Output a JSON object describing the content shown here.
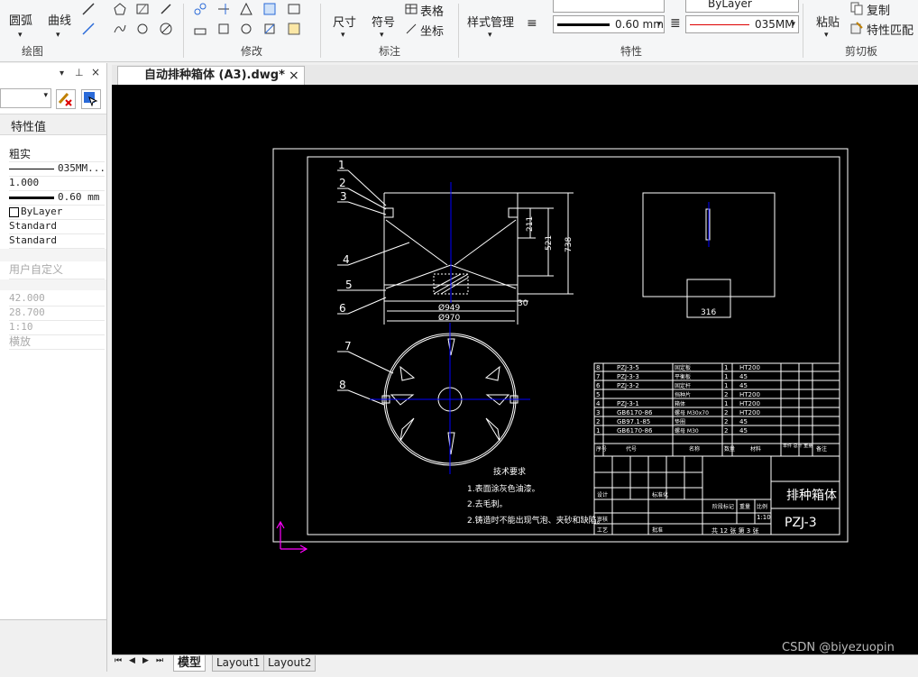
{
  "ribbon": {
    "draw": {
      "arc": "圆弧",
      "curve": "曲线",
      "group": "绘图"
    },
    "modify": {
      "group": "修改"
    },
    "annotate": {
      "dim": "尺寸",
      "symbol": "符号",
      "table": "表格",
      "coord": "坐标",
      "group": "标注"
    },
    "props": {
      "style_mgr": "样式管理",
      "lineweight": "0.60 mm",
      "bylayer": "ByLayer",
      "linetype": "035MM",
      "group": "特性"
    },
    "clipboard": {
      "paste": "粘贴",
      "copy": "复制",
      "match": "特性匹配",
      "group": "剪切板"
    }
  },
  "left_panel": {
    "header": "特性值",
    "rows": [
      "粗实",
      "035MM...",
      "1.000",
      "0.60 mm",
      "ByLayer",
      "Standard",
      "Standard"
    ],
    "user_defined": "用户自定义",
    "gray_rows": [
      "42.000",
      "28.700",
      "1:10",
      "横放"
    ]
  },
  "document_tab": {
    "title": "自动排种箱体 (A3).dwg*",
    "close": "×"
  },
  "layout_tabs": [
    "模型",
    "Layout1",
    "Layout2"
  ],
  "drawing": {
    "balloons": [
      "1",
      "2",
      "3",
      "4",
      "5",
      "6",
      "7",
      "8"
    ],
    "dims": {
      "d949": "Ø949",
      "d970": "Ø970",
      "h738": "738",
      "h521": "521",
      "h211": "211",
      "w30": "30",
      "w316": "316"
    },
    "tech_title": "技术要求",
    "tech_notes": [
      "1.表面涂灰色油漆。",
      "2.去毛刺。",
      "2.铸造时不能出现气泡、夹砂和缺陷。"
    ],
    "bom": [
      {
        "no": "8",
        "code": "PZJ-3-5",
        "name": "固定板",
        "qty": "1",
        "mat": "HT200"
      },
      {
        "no": "7",
        "code": "PZJ-3-3",
        "name": "平衡板",
        "qty": "1",
        "mat": "45"
      },
      {
        "no": "6",
        "code": "PZJ-3-2",
        "name": "固定杆",
        "qty": "1",
        "mat": "45"
      },
      {
        "no": "5",
        "code": "",
        "name": "挡种片",
        "qty": "2",
        "mat": "HT200"
      },
      {
        "no": "4",
        "code": "PZJ-3-1",
        "name": "箱体",
        "qty": "1",
        "mat": "HT200"
      },
      {
        "no": "3",
        "code": "GB6170-86",
        "name": "螺母 M30x70",
        "qty": "2",
        "mat": "HT200"
      },
      {
        "no": "2",
        "code": "GB97.1-85",
        "name": "垫圈",
        "qty": "2",
        "mat": "45"
      },
      {
        "no": "1",
        "code": "GB6170-86",
        "name": "螺母 M30",
        "qty": "2",
        "mat": "45"
      }
    ],
    "bom_header": {
      "no": "序号",
      "code": "代号",
      "name": "名称",
      "qty": "数量",
      "mat": "材料",
      "weight": "单件 总计 重量",
      "note": "备注"
    },
    "title_block": {
      "name": "排种箱体",
      "code": "PZJ-3",
      "scale": "1:10",
      "sheet": "共 12 张 第 3 张",
      "design": "设计",
      "review": "审核",
      "process": "工艺",
      "approve": "批准",
      "stage": "阶段标记",
      "weight": "重量",
      "ratio": "比例",
      "standard": "标准化"
    }
  },
  "watermark": "CSDN @biyezuopin",
  "colors": {
    "canvas": "#000000",
    "drawing": "#ffffff",
    "center_line": "#0000ff",
    "ucs": "#ff00ff"
  }
}
